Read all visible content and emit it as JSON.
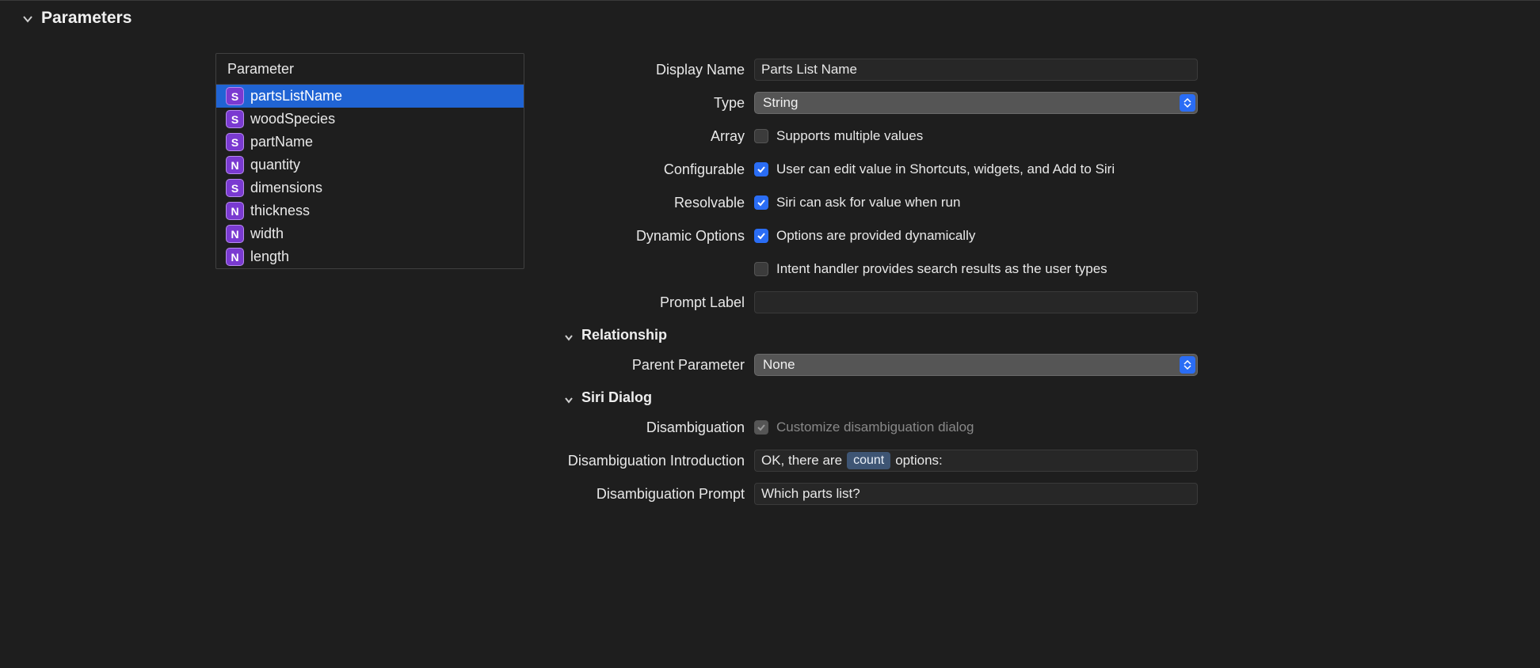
{
  "section_title": "Parameters",
  "param_list_header": "Parameter",
  "parameters": [
    {
      "name": "partsListName",
      "typeBadge": "S",
      "selected": true
    },
    {
      "name": "woodSpecies",
      "typeBadge": "S",
      "selected": false
    },
    {
      "name": "partName",
      "typeBadge": "S",
      "selected": false
    },
    {
      "name": "quantity",
      "typeBadge": "N",
      "selected": false
    },
    {
      "name": "dimensions",
      "typeBadge": "S",
      "selected": false
    },
    {
      "name": "thickness",
      "typeBadge": "N",
      "selected": false
    },
    {
      "name": "width",
      "typeBadge": "N",
      "selected": false
    },
    {
      "name": "length",
      "typeBadge": "N",
      "selected": false
    }
  ],
  "form": {
    "labels": {
      "display_name": "Display Name",
      "type": "Type",
      "array": "Array",
      "configurable": "Configurable",
      "resolvable": "Resolvable",
      "dynamic_options": "Dynamic Options",
      "prompt_label": "Prompt Label",
      "relationship_hdr": "Relationship",
      "parent_parameter": "Parent Parameter",
      "siri_dialog_hdr": "Siri Dialog",
      "disambiguation": "Disambiguation",
      "disambiguation_intro": "Disambiguation Introduction",
      "disambiguation_prompt": "Disambiguation Prompt"
    },
    "display_name_value": "Parts List Name",
    "type_value": "String",
    "array_checked": false,
    "array_label": "Supports multiple values",
    "configurable_checked": true,
    "configurable_label": "User can edit value in Shortcuts, widgets, and Add to Siri",
    "resolvable_checked": true,
    "resolvable_label": "Siri can ask for value when run",
    "dynamic_options_checked": true,
    "dynamic_options_label": "Options are provided dynamically",
    "dynamic_search_checked": false,
    "dynamic_search_label": "Intent handler provides search results as the user types",
    "prompt_label_value": "",
    "parent_parameter_value": "None",
    "disambiguation_checked_disabled": true,
    "disambiguation_label": "Customize disambiguation dialog",
    "disambiguation_intro_pre": "OK, there are",
    "disambiguation_intro_token": "count",
    "disambiguation_intro_post": "options:",
    "disambiguation_prompt_value": "Which parts list?"
  }
}
